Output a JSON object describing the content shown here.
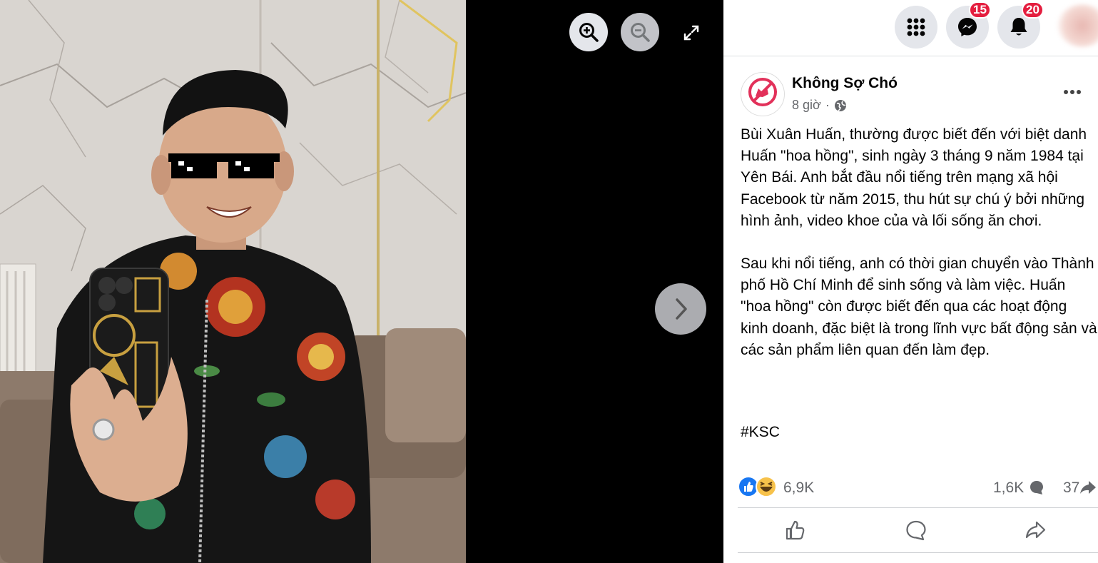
{
  "viewer": {
    "controls": [
      "zoom-in-icon",
      "zoom-out-icon",
      "fullscreen-icon",
      "next-arrow-icon"
    ]
  },
  "topbar": {
    "menu_icon": "grid-menu-icon",
    "messenger_badge": "15",
    "notifications_badge": "20"
  },
  "post": {
    "page_name": "Không Sợ Chó",
    "avatar_label": "Không Sợ Chó",
    "time": "8 giờ",
    "separator": "·",
    "audience_icon": "globe-icon",
    "paragraphs": [
      "Bùi Xuân Huấn, thường được biết đến với biệt danh Huấn \"hoa hồng\", sinh ngày 3 tháng 9 năm 1984 tại Yên Bái. Anh bắt đầu nổi tiếng trên mạng xã hội Facebook từ năm 2015, thu hút sự chú ý bởi những hình ảnh, video khoe của và lối sống ăn chơi.",
      "Sau khi nổi tiếng, anh có thời gian chuyển vào Thành phố Hồ Chí Minh để sinh sống và làm việc. Huấn \"hoa hồng\" còn được biết đến qua các hoạt động kinh doanh, đặc biệt là trong lĩnh vực bất động sản và các sản phẩm liên quan đến làm đẹp."
    ],
    "hashtag": "#KSC",
    "reactions_count": "6,9K",
    "comments_count": "1,6K",
    "shares_count": "37"
  },
  "colors": {
    "accent": "#1877f2",
    "badge": "#e41e3f",
    "secondary_text": "#65676b"
  }
}
